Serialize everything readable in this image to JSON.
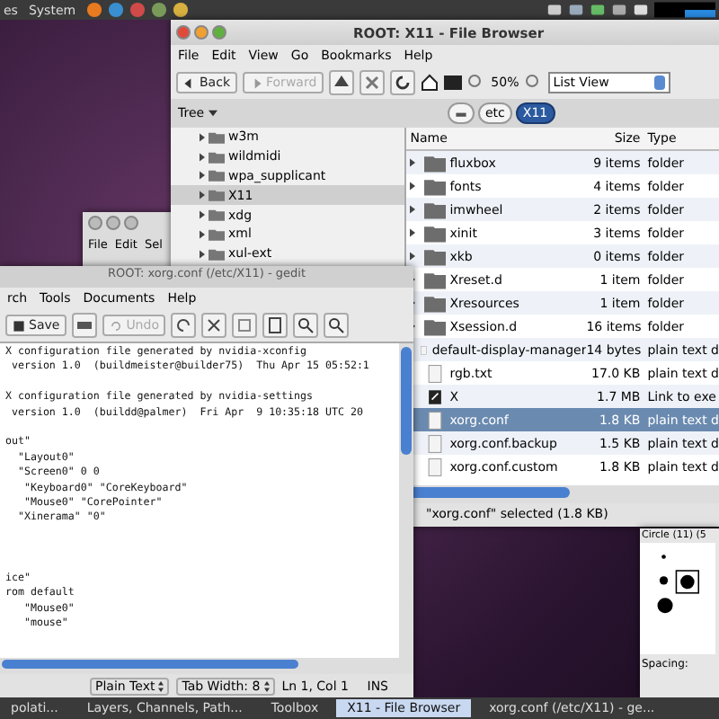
{
  "top_panel": {
    "menus": [
      "es",
      "System"
    ]
  },
  "file_browser": {
    "title": "ROOT: X11 - File Browser",
    "menu": [
      "File",
      "Edit",
      "View",
      "Go",
      "Bookmarks",
      "Help"
    ],
    "toolbar": {
      "back": "Back",
      "forward": "Forward",
      "forward_disabled": true,
      "zoom": "50%",
      "view": "List View"
    },
    "tree_label": "Tree",
    "path": [
      {
        "label": "etc",
        "selected": false
      },
      {
        "label": "X11",
        "selected": true
      }
    ],
    "tree": [
      {
        "name": "w3m",
        "selected": false
      },
      {
        "name": "wildmidi",
        "selected": false
      },
      {
        "name": "wpa_supplicant",
        "selected": false
      },
      {
        "name": "X11",
        "selected": true
      },
      {
        "name": "xdg",
        "selected": false
      },
      {
        "name": "xml",
        "selected": false
      },
      {
        "name": "xul-ext",
        "selected": false
      }
    ],
    "columns": [
      "Name",
      "Size",
      "Type"
    ],
    "rows": [
      {
        "name": "fluxbox",
        "size": "9 items",
        "type": "folder",
        "kind": "folder",
        "selected": false
      },
      {
        "name": "fonts",
        "size": "4 items",
        "type": "folder",
        "kind": "folder",
        "selected": false
      },
      {
        "name": "imwheel",
        "size": "2 items",
        "type": "folder",
        "kind": "folder",
        "selected": false
      },
      {
        "name": "xinit",
        "size": "3 items",
        "type": "folder",
        "kind": "folder",
        "selected": false
      },
      {
        "name": "xkb",
        "size": "0 items",
        "type": "folder",
        "kind": "folder",
        "selected": false
      },
      {
        "name": "Xreset.d",
        "size": "1 item",
        "type": "folder",
        "kind": "folder",
        "selected": false
      },
      {
        "name": "Xresources",
        "size": "1 item",
        "type": "folder",
        "kind": "folder",
        "selected": false
      },
      {
        "name": "Xsession.d",
        "size": "16 items",
        "type": "folder",
        "kind": "folder",
        "selected": false
      },
      {
        "name": "default-display-manager",
        "size": "14 bytes",
        "type": "plain text d",
        "kind": "text",
        "selected": false
      },
      {
        "name": "rgb.txt",
        "size": "17.0 KB",
        "type": "plain text d",
        "kind": "text",
        "selected": false
      },
      {
        "name": "X",
        "size": "1.7 MB",
        "type": "Link to exe",
        "kind": "link",
        "selected": false
      },
      {
        "name": "xorg.conf",
        "size": "1.8 KB",
        "type": "plain text d",
        "kind": "text",
        "selected": true
      },
      {
        "name": "xorg.conf.backup",
        "size": "1.5 KB",
        "type": "plain text d",
        "kind": "text",
        "selected": false
      },
      {
        "name": "xorg.conf.custom",
        "size": "1.8 KB",
        "type": "plain text d",
        "kind": "text",
        "selected": false
      }
    ],
    "status": "\"xorg.conf\" selected (1.8 KB)"
  },
  "back_window": {
    "menu": [
      "File",
      "Edit",
      "Sel"
    ]
  },
  "gedit": {
    "title": "ROOT: xorg.conf (/etc/X11) - gedit",
    "menu": [
      "rch",
      "Tools",
      "Documents",
      "Help"
    ],
    "toolbar": {
      "save": "Save",
      "undo": "Undo",
      "undo_disabled": true
    },
    "lines": [
      {
        "kind": "text",
        "text": "X configuration file generated by nvidia-xconfig"
      },
      {
        "kind": "text",
        "text": " version 1.0  (buildmeister@builder75)  Thu Apr 15 05:52:1"
      },
      {
        "kind": "blank"
      },
      {
        "kind": "text",
        "text": "X configuration file generated by nvidia-settings"
      },
      {
        "kind": "text",
        "text": " version 1.0  (buildd@palmer)  Fri Apr  9 10:35:18 UTC 20"
      },
      {
        "kind": "blank"
      },
      {
        "kind": "text",
        "text": "out\""
      },
      {
        "kind": "text",
        "text": "  \"Layout0\""
      },
      {
        "kind": "text",
        "text": "  \"Screen0\" 0 0"
      },
      {
        "kind": "text",
        "text": "   \"Keyboard0\" \"CoreKeyboard\""
      },
      {
        "kind": "text",
        "text": "   \"Mouse0\" \"CorePointer\""
      },
      {
        "kind": "text",
        "text": "  \"Xinerama\" \"0\""
      },
      {
        "kind": "blank"
      },
      {
        "kind": "blank"
      },
      {
        "kind": "blank"
      },
      {
        "kind": "text",
        "text": "ice\""
      },
      {
        "kind": "text",
        "text": "rom default"
      },
      {
        "kind": "text",
        "text": "   \"Mouse0\""
      },
      {
        "kind": "text",
        "text": "   \"mouse\""
      }
    ],
    "status": {
      "language": "Plain Text",
      "tab_width": "Tab Width: 8",
      "position": "Ln 1, Col 1",
      "mode": "INS"
    }
  },
  "brush_dialog": {
    "title": "Circle (11) (5",
    "spacing": "Spacing:"
  },
  "taskbar": [
    {
      "label": "polati...",
      "selected": false
    },
    {
      "label": "Layers, Channels, Path...",
      "selected": false
    },
    {
      "label": "Toolbox",
      "selected": false
    },
    {
      "label": "X11 - File Browser",
      "selected": true
    },
    {
      "label": "xorg.conf (/etc/X11) - ge...",
      "selected": false
    }
  ]
}
